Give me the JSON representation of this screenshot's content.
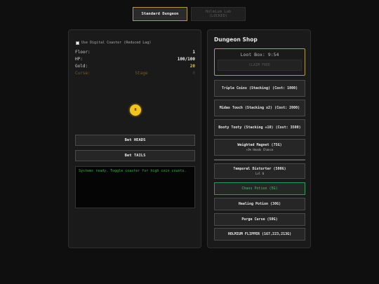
{
  "tabs": {
    "standard": "Standard Dungeon",
    "holmium_line1": "Holmium Lab",
    "holmium_line2": "(LOCKED)"
  },
  "dungeon": {
    "coaster_label": "Use Digital Coaster (Reduced Lag)",
    "floor_label": "Floor:",
    "floor_value": "1",
    "hp_label": "HP:",
    "hp_value": "100/100",
    "gold_label": "Gold:",
    "gold_value": "20",
    "curse_label": "Curse:",
    "curse_stage": "Stage",
    "curse_value": "0",
    "coin_face": "H",
    "bet_heads": "Bet HEADS",
    "bet_tails": "Bet TAILS",
    "log_text": "Systems ready. Toggle coaster for high coin counts."
  },
  "shop": {
    "title": "Dungeon Shop",
    "loot_box": "Loot Box: 9:54",
    "claim": "CLAIM FREE",
    "items": [
      {
        "label": "Triple Coins (Stacking) (Cost: 1000)"
      },
      {
        "label": "Midas Touch (Stacking x2) (Cost: 2000)"
      },
      {
        "label": "Booty Tooty (Stacking +10) (Cost: 3500)"
      },
      {
        "label": "Weighted Magnet (75G)",
        "sub": "+3% Heads Chance"
      },
      {
        "label": "Temporal Distorter (500G)",
        "sub": "Lvl 0"
      },
      {
        "label": "Chaos Potion (5G)"
      },
      {
        "label": "Healing Potion (30G)"
      },
      {
        "label": "Purge Curse (50G)"
      },
      {
        "label": "HOLMIUM FLIPPER (167,223,213G)"
      }
    ]
  },
  "colors": {
    "accent_gold": "#b39a4a",
    "gold_value": "#e8c030",
    "log_green": "#3cb043",
    "chaos_green": "#2e9a5a"
  }
}
